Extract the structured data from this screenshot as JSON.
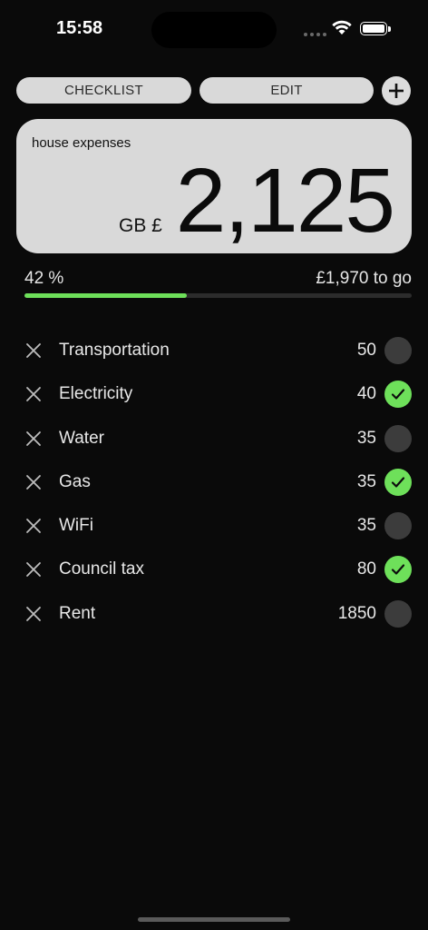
{
  "status_bar": {
    "time": "15:58"
  },
  "toolbar": {
    "checklist_label": "CHECKLIST",
    "edit_label": "EDIT",
    "add_icon": "plus-icon"
  },
  "card": {
    "title": "house expenses",
    "currency": "GB £",
    "amount": "2,125"
  },
  "progress": {
    "percent_label": "42 %",
    "remaining_label": "£1,970 to go",
    "fraction": 0.42
  },
  "colors": {
    "accent": "#6ee05a",
    "card_bg": "#d9d9d9",
    "background": "#0a0a0a"
  },
  "items": [
    {
      "name": "Transportation",
      "amount": "50",
      "checked": false
    },
    {
      "name": "Electricity",
      "amount": "40",
      "checked": true
    },
    {
      "name": "Water",
      "amount": "35",
      "checked": false
    },
    {
      "name": "Gas",
      "amount": "35",
      "checked": true
    },
    {
      "name": "WiFi",
      "amount": "35",
      "checked": false
    },
    {
      "name": "Council tax",
      "amount": "80",
      "checked": true
    },
    {
      "name": "Rent",
      "amount": "1850",
      "checked": false
    }
  ]
}
